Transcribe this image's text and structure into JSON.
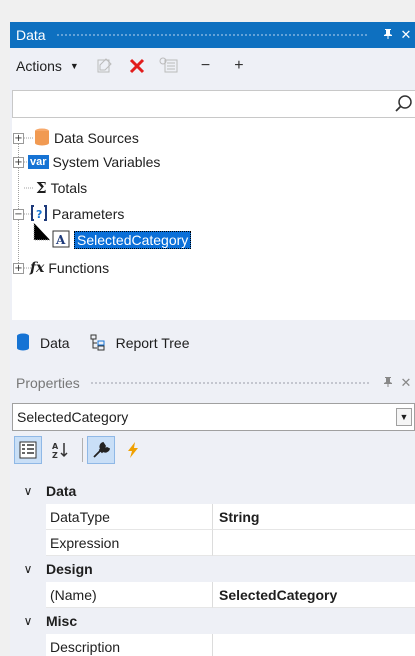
{
  "data_panel": {
    "title": "Data",
    "pin": "ᵖ",
    "close": "✕"
  },
  "toolbar": {
    "actions_label": "Actions",
    "minus": "−",
    "plus": "+"
  },
  "search": {
    "value": ""
  },
  "tree": {
    "items": [
      {
        "label": "Data Sources",
        "expander": "+"
      },
      {
        "label": "System Variables",
        "expander": "+",
        "icon_text": "var"
      },
      {
        "label": "Totals"
      },
      {
        "label": "Parameters",
        "expander": "−"
      },
      {
        "label": "SelectedCategory",
        "selected": true
      },
      {
        "label": "Functions",
        "expander": "+",
        "icon_text": "fx"
      }
    ]
  },
  "tabs": [
    {
      "label": "Data"
    },
    {
      "label": "Report Tree"
    }
  ],
  "properties_panel": {
    "title": "Properties",
    "close": "✕",
    "selected_object": "SelectedCategory"
  },
  "grid": {
    "categories": [
      {
        "label": "Data",
        "rows": [
          {
            "name": "DataType",
            "value": "String"
          },
          {
            "name": "Expression",
            "value": ""
          }
        ]
      },
      {
        "label": "Design",
        "rows": [
          {
            "name": "(Name)",
            "value": "SelectedCategory"
          }
        ]
      },
      {
        "label": "Misc",
        "rows": [
          {
            "name": "Description",
            "value": ""
          }
        ]
      }
    ]
  },
  "colors": {
    "accent": "#0e70c0",
    "selection": "#0a6fd8",
    "delete": "#e21d1d",
    "event": "#f0a000"
  }
}
